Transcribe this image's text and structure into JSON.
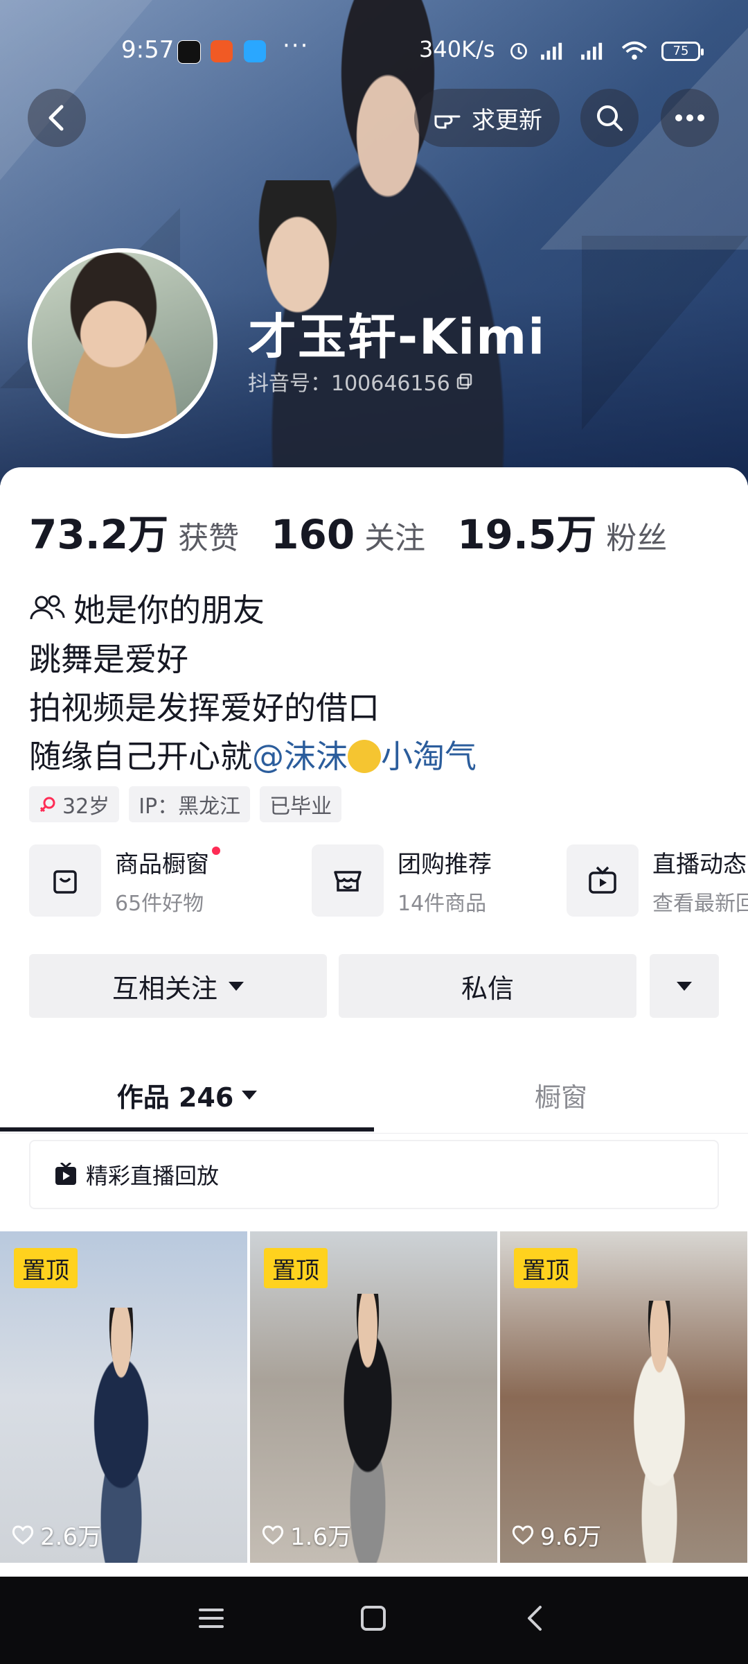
{
  "status_bar": {
    "time": "9:57",
    "dots": "···",
    "network_speed": "340K/s",
    "battery": "75"
  },
  "header": {
    "update_request_label": "求更新",
    "profile_name": "才玉轩-Kimi",
    "douyin_id": "抖音号：100646156"
  },
  "stats": [
    {
      "value": "73.2万",
      "label": "获赞"
    },
    {
      "value": "160",
      "label": "关注"
    },
    {
      "value": "19.5万",
      "label": "粉丝"
    }
  ],
  "relation": "她是你的朋友",
  "bio": {
    "line1": "跳舞是爱好",
    "line2": "拍视频是发挥爱好的借口",
    "line3_text": "随缘自己开心就",
    "mention1": "@沫沫",
    "mention2": "小淘气"
  },
  "tags": {
    "age": "32岁",
    "ip": "IP：黑龙江",
    "education": "已毕业"
  },
  "shops": [
    {
      "title": "商品橱窗",
      "subtitle": "65件好物",
      "icon": "bag-icon"
    },
    {
      "title": "团购推荐",
      "subtitle": "14件商品",
      "icon": "store-icon"
    },
    {
      "title": "直播动态",
      "subtitle": "查看最新回",
      "icon": "live-tv-icon"
    }
  ],
  "actions": {
    "follow_label": "互相关注",
    "message_label": "私信"
  },
  "tabs": {
    "works_label": "作品 246",
    "showcase_label": "橱窗"
  },
  "replay_label": "精彩直播回放",
  "videos": [
    {
      "pinned_label": "置顶",
      "likes": "2.6万"
    },
    {
      "pinned_label": "置顶",
      "likes": "1.6万"
    },
    {
      "pinned_label": "置顶",
      "likes": "9.6万"
    }
  ],
  "colors": {
    "mention": "#2b5d9c",
    "pin_badge": "#ffd21e",
    "notify_dot": "#fe2c55"
  }
}
